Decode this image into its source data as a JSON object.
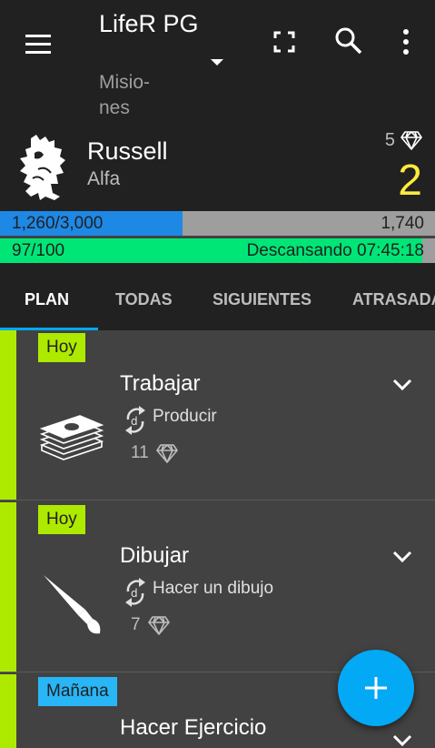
{
  "app_bar": {
    "title": "LifeR PG",
    "subtitle": "Misio- nes",
    "icons": [
      "menu-icon",
      "dropdown-icon",
      "fullscreen-icon",
      "search-icon",
      "more-vert-icon"
    ]
  },
  "player": {
    "name": "Russell",
    "rank": "Alfa",
    "gems": "5",
    "level": "2",
    "level_color": "#ffeb3b"
  },
  "xp_bar": {
    "current": "1,260",
    "total": "/3,000",
    "remaining": "1,740",
    "fill_fraction": 0.42,
    "color": "#1e88e5"
  },
  "hp_bar": {
    "label": "97/100",
    "status": "Descansando 07:45:18",
    "fill_fraction": 0.97,
    "color": "#00e676"
  },
  "tabs": [
    {
      "label": "PLAN",
      "active": true
    },
    {
      "label": "TODAS",
      "active": false
    },
    {
      "label": "SIGUIENTES",
      "active": false
    },
    {
      "label": "ATRASADAS",
      "active": false
    }
  ],
  "missions": [
    {
      "badge": "Hoy",
      "badge_color": "#aeea00",
      "title": "Trabajar",
      "repeat": "Producir",
      "reward": "11",
      "icon": "money-stack-icon"
    },
    {
      "badge": "Hoy",
      "badge_color": "#aeea00",
      "title": "Dibujar",
      "repeat": "Hacer un dibujo",
      "reward": "7",
      "icon": "paintbrush-icon"
    },
    {
      "badge": "Mañana",
      "badge_color": "#29b6f6",
      "title": "Hacer Ejercicio",
      "repeat": "",
      "reward": "",
      "icon": ""
    }
  ],
  "fab": {
    "icon": "plus-icon",
    "color": "#03a9f4"
  }
}
